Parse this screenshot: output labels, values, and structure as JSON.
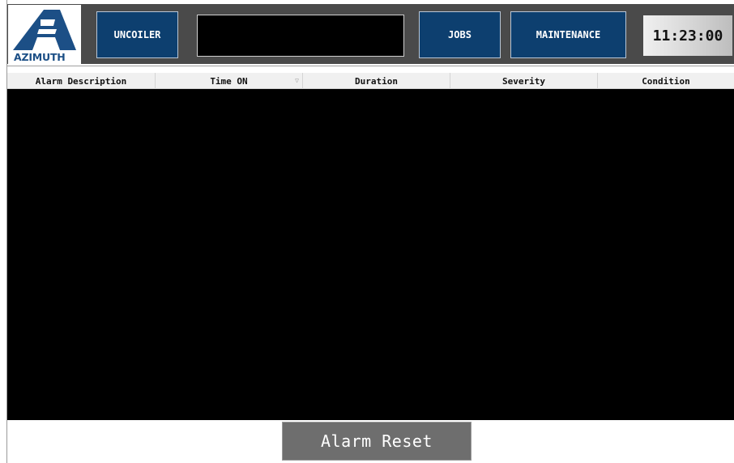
{
  "logo": {
    "text": "AZIMUTH",
    "brand_color": "#1c4f86"
  },
  "nav": {
    "uncoiler_label": "UNCOILER",
    "jobs_label": "JOBS",
    "maintenance_label": "MAINTENANCE"
  },
  "status": {
    "value": ""
  },
  "clock": {
    "time": "11:23:00"
  },
  "alarm_table": {
    "columns": [
      "Alarm Description",
      "Time ON",
      "Duration",
      "Severity",
      "Condition"
    ],
    "sort_icon": "sort-triangle-icon",
    "rows": []
  },
  "footer": {
    "reset_label": "Alarm Reset"
  },
  "colors": {
    "header_bg": "#4a4a4a",
    "nav_button_bg": "#0d3f6f",
    "table_bg": "#000000",
    "reset_bg": "#6e6e6e"
  }
}
